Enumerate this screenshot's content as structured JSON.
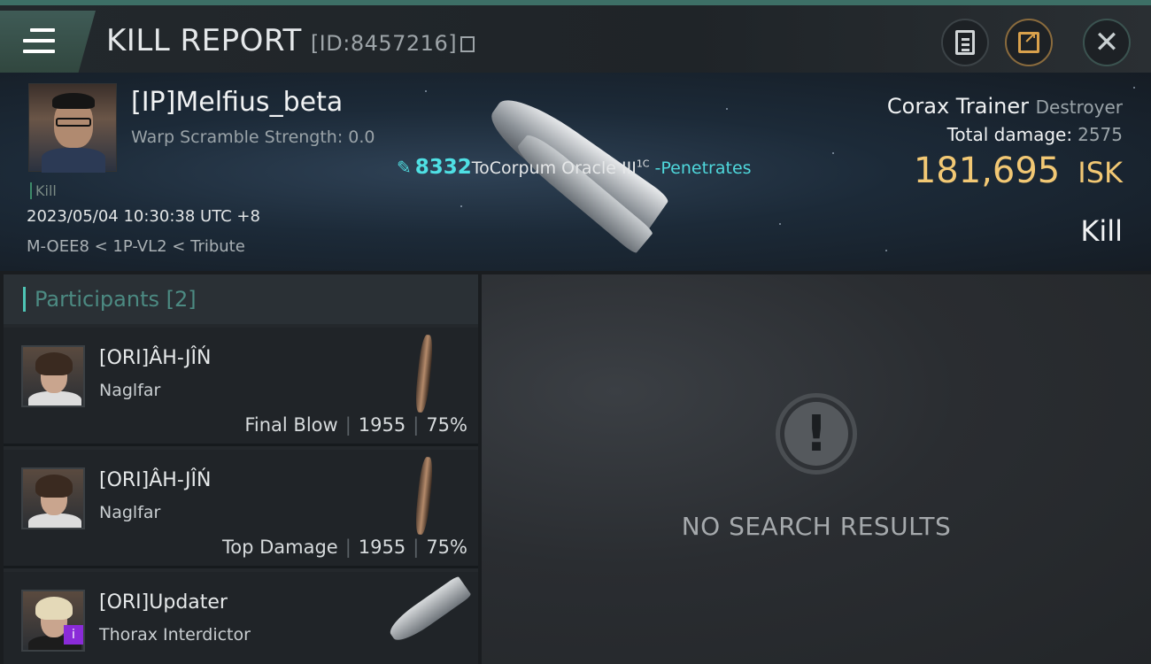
{
  "header": {
    "title": "KILL REPORT",
    "report_id": "[ID:8457216]"
  },
  "victim": {
    "name": "[IP]Melfius_beta",
    "warp_scramble": "Warp Scramble Strength: 0.0",
    "kill_tag": "Kill",
    "datetime": "2023/05/04 10:30:38 UTC +8",
    "location": "M-OEE8 < 1P-VL2 < Tribute",
    "hit": {
      "damage": "8332",
      "text": "ToCorpum Oracle III",
      "superscript": "1C",
      "effect": "-Penetrates"
    },
    "ship_name": "Corax Trainer",
    "ship_class": "Destroyer",
    "total_damage_label": "Total damage:",
    "total_damage_value": "2575",
    "isk_value": "181,695",
    "isk_unit": "ISK",
    "result": "Kill"
  },
  "participants": {
    "label": "Participants",
    "count": "[2]",
    "items": [
      {
        "name": "[ORI]ÂH-JÎŃ",
        "ship": "Naglfar",
        "role": "Final Blow",
        "damage": "1955",
        "percent": "75%"
      },
      {
        "name": "[ORI]ÂH-JÎŃ",
        "ship": "Naglfar",
        "role": "Top Damage",
        "damage": "1955",
        "percent": "75%"
      },
      {
        "name": "[ORI]Updater",
        "ship": "Thorax Interdictor"
      }
    ]
  },
  "results": {
    "empty_text": "NO SEARCH RESULTS"
  },
  "colors": {
    "accent": "#4ec5b5",
    "isk": "#f2c874",
    "hit_cyan": "#4fe0e4"
  },
  "icons": {
    "menu": "menu-icon",
    "report": "clipboard-icon",
    "share": "share-icon",
    "close": "close-icon",
    "alert": "exclamation-icon"
  }
}
